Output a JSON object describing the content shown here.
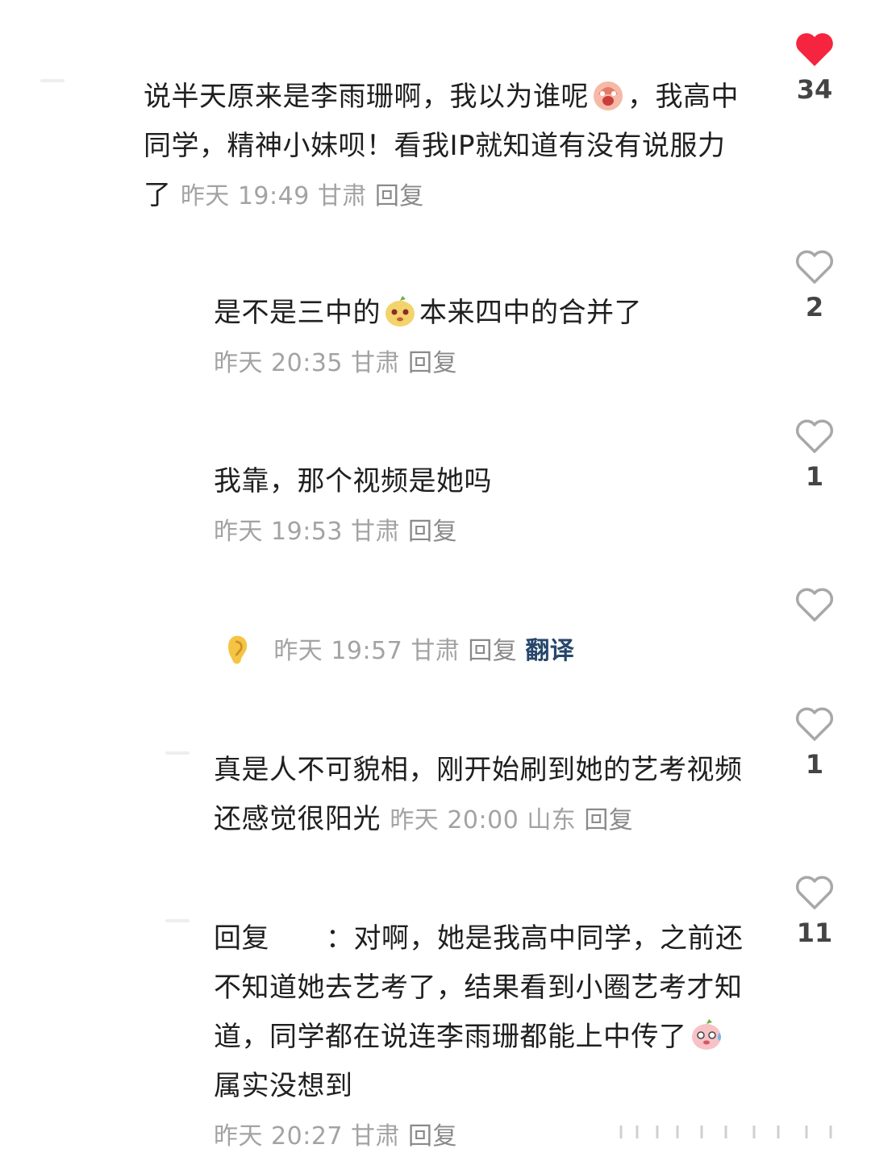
{
  "comments": [
    {
      "text_a": "说半天原来是李雨珊啊，我以为谁呢",
      "text_b": "，我高中同学，精神小妹呗！看我IP就知道有没有说服力了",
      "time": "昨天 19:49",
      "region": "甘肃",
      "reply": "回复",
      "likes": "34",
      "liked": true
    },
    {
      "text_a": "是不是三中的",
      "text_b": "本来四中的合并了",
      "time": "昨天 20:35",
      "region": "甘肃",
      "reply": "回复",
      "likes": "2"
    },
    {
      "text": "我靠，那个视频是她吗",
      "time": "昨天 19:53",
      "region": "甘肃",
      "reply": "回复",
      "likes": "1"
    },
    {
      "time": "昨天 19:57",
      "region": "甘肃",
      "reply": "回复",
      "translate": "翻译",
      "likes": ""
    },
    {
      "text": "真是人不可貌相，刚开始刷到她的艺考视频还感觉很阳光",
      "time": "昨天 20:00",
      "region": "山东",
      "reply": "回复",
      "likes": "1"
    },
    {
      "prefix": "回复",
      "text_a": "：对啊，她是我高中同学，之前还不知道她去艺考了，结果看到小圈艺考才知道，同学都在说连李雨珊都能上中传了",
      "text_b": "属实没想到",
      "time": "昨天 20:27",
      "region": "甘肃",
      "reply": "回复",
      "likes": "11"
    }
  ],
  "colors": {
    "liked_heart": "#f5243f",
    "heart_outline": "#a8a8a8",
    "meta_text": "#a3a3a3",
    "translate": "#27466b"
  }
}
